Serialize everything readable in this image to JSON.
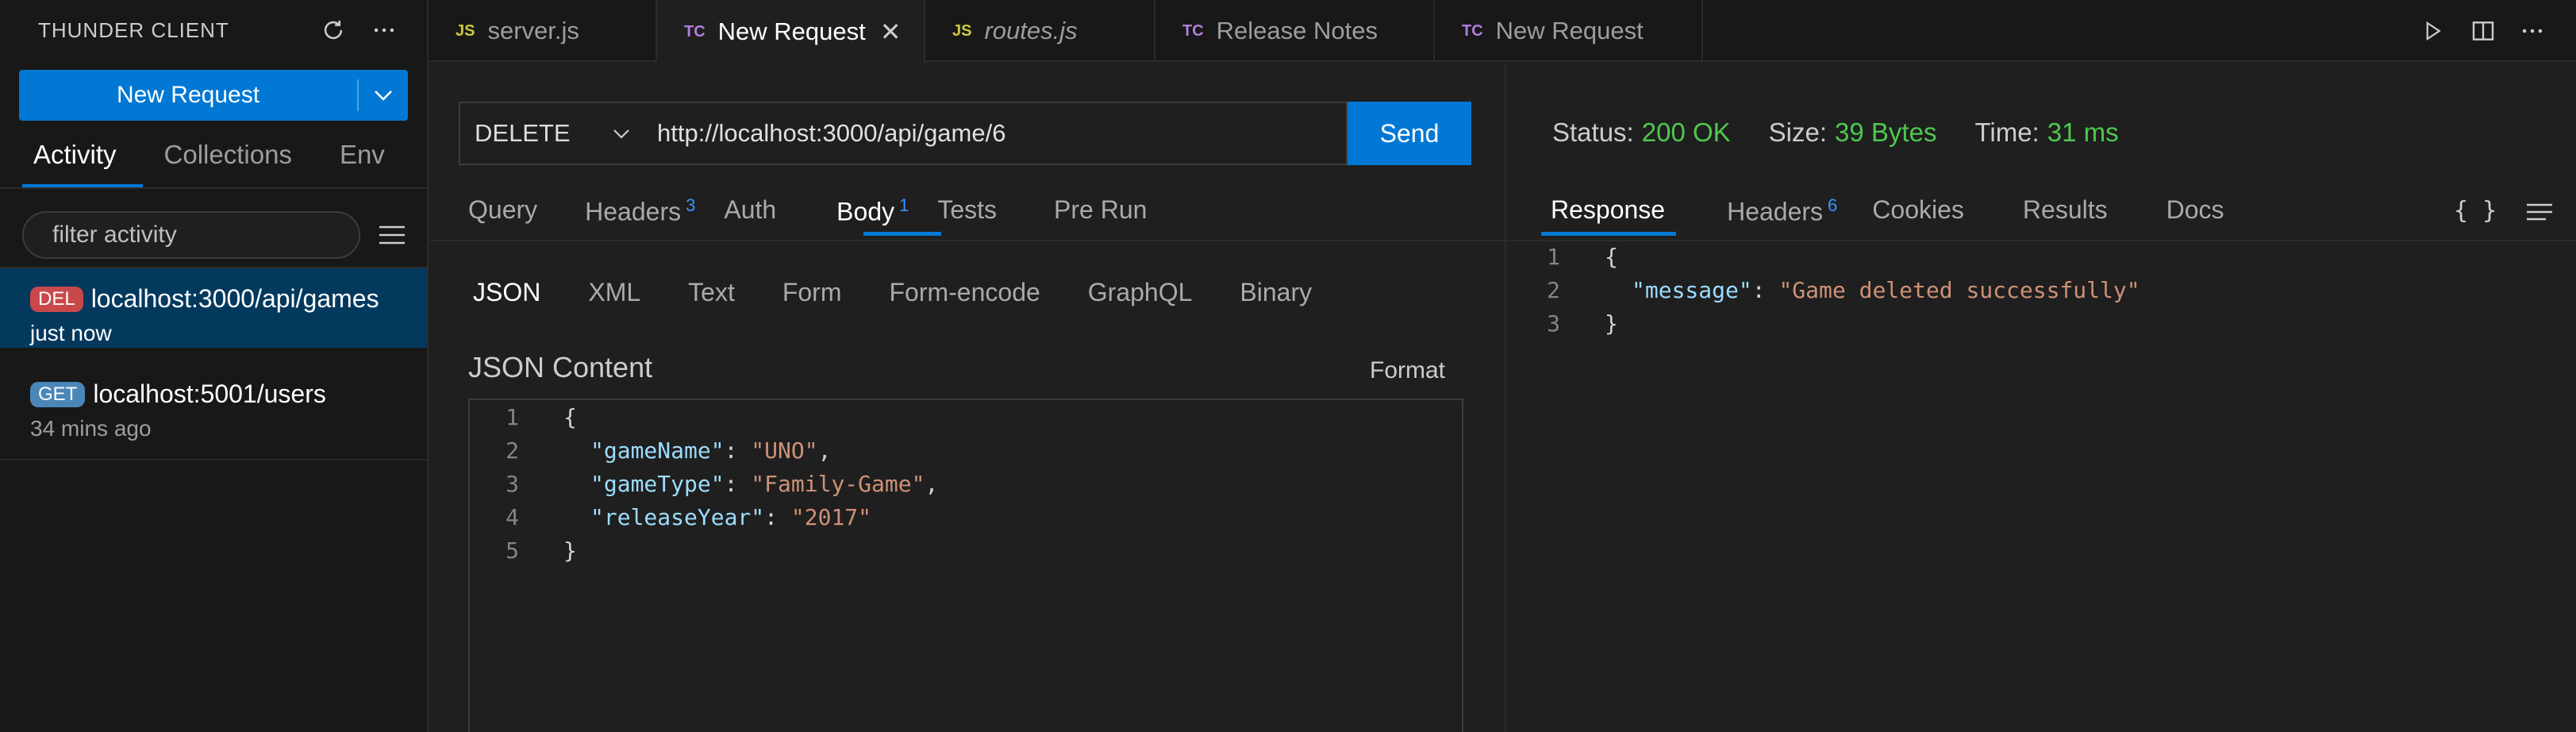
{
  "sidebar": {
    "title": "THUNDER CLIENT",
    "new_request": "New Request",
    "tabs": [
      "Activity",
      "Collections",
      "Env"
    ],
    "filter_placeholder": "filter activity",
    "activity": [
      {
        "method": "DEL",
        "url": "localhost:3000/api/games",
        "time": "just now"
      },
      {
        "method": "GET",
        "url": "localhost:5001/users",
        "time": "34 mins ago"
      }
    ]
  },
  "editor_tabs": [
    {
      "icon": "JS",
      "label": "server.js"
    },
    {
      "icon": "TC",
      "label": "New Request"
    },
    {
      "icon": "JS",
      "label": "routes.js"
    },
    {
      "icon": "TC",
      "label": "Release Notes"
    },
    {
      "icon": "TC",
      "label": "New Request"
    }
  ],
  "request": {
    "method": "DELETE",
    "url": "http://localhost:3000/api/game/6",
    "send": "Send",
    "tabs": [
      "Query",
      "Headers",
      "Auth",
      "Body",
      "Tests",
      "Pre Run"
    ],
    "headers_count": "3",
    "body_count": "1",
    "body_tabs": [
      "JSON",
      "XML",
      "Text",
      "Form",
      "Form-encode",
      "GraphQL",
      "Binary"
    ],
    "json_label": "JSON Content",
    "format": "Format",
    "json_lines": [
      {
        "n": "1",
        "open": "{"
      },
      {
        "n": "2",
        "key": "\"gameName\"",
        "colon": ": ",
        "value": "\"UNO\"",
        "tail": ","
      },
      {
        "n": "3",
        "key": "\"gameType\"",
        "colon": ": ",
        "value": "\"Family-Game\"",
        "tail": ","
      },
      {
        "n": "4",
        "key": "\"releaseYear\"",
        "colon": ": ",
        "value": "\"2017\"",
        "tail": ""
      },
      {
        "n": "5",
        "open": "}"
      }
    ]
  },
  "response": {
    "status_label": "Status:",
    "status_value": "200 OK",
    "size_label": "Size:",
    "size_value": "39 Bytes",
    "time_label": "Time:",
    "time_value": "31 ms",
    "tabs": [
      "Response",
      "Headers",
      "Cookies",
      "Results",
      "Docs"
    ],
    "headers_count": "6",
    "braces": "{ }",
    "lines": [
      {
        "n": "1",
        "open": "{"
      },
      {
        "n": "2",
        "key": "\"message\"",
        "colon": ": ",
        "value": "\"Game deleted successfully\""
      },
      {
        "n": "3",
        "open": "}"
      }
    ]
  },
  "colors": {
    "accent": "#0078d4",
    "ok": "#4ec94e",
    "del_badge": "#c9484a",
    "get_badge": "#4a86b8"
  }
}
